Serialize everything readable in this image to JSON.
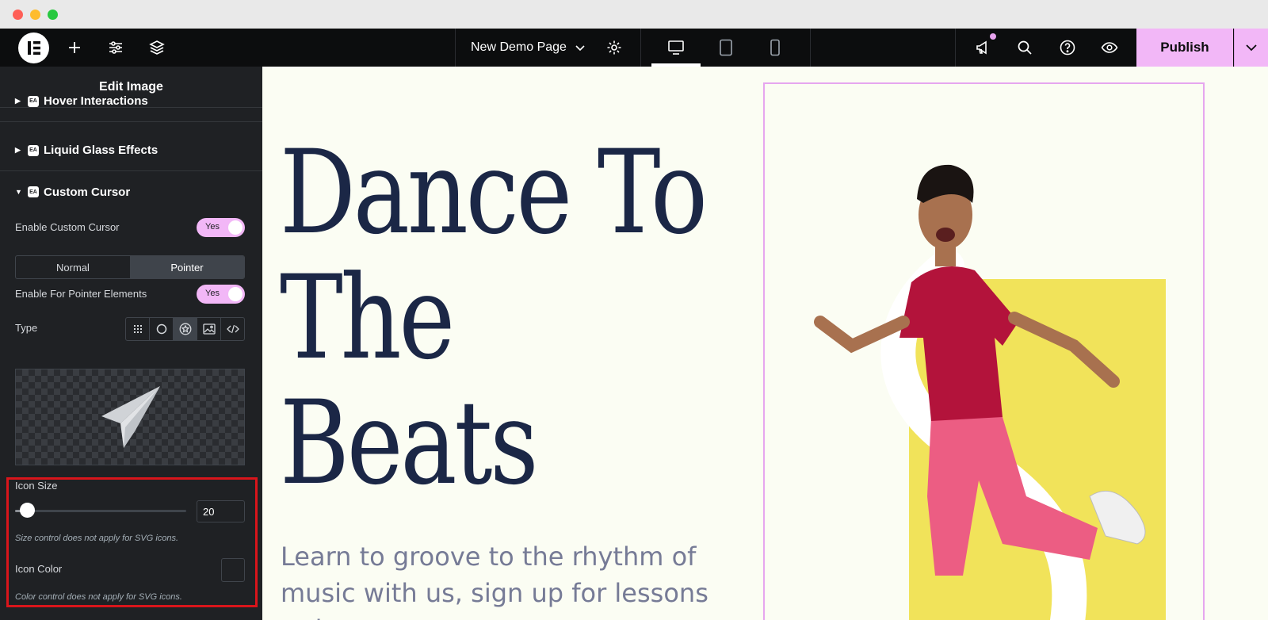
{
  "window": {
    "controls": [
      "close",
      "minimize",
      "zoom"
    ]
  },
  "topbar": {
    "page_name": "New Demo Page",
    "publish_label": "Publish",
    "icons": [
      "elementor-logo-icon",
      "add-icon",
      "settings-sliders-icon",
      "layers-icon",
      "chevron-down-icon",
      "gear-icon",
      "desktop-icon",
      "tablet-icon",
      "mobile-icon",
      "announcement-icon",
      "search-icon",
      "help-icon",
      "eye-icon"
    ]
  },
  "panel": {
    "title": "Edit Image",
    "sections": {
      "hover": "Hover Interactions",
      "liquid": "Liquid Glass Effects",
      "cursor": "Custom Cursor"
    },
    "badge": "EA",
    "enable_cursor_label": "Enable Custom Cursor",
    "enable_cursor_value": "Yes",
    "mode_normal": "Normal",
    "mode_pointer": "Pointer",
    "mode_selected": "Pointer",
    "pointer_elements_label": "Enable For Pointer Elements",
    "pointer_elements_value": "Yes",
    "type_label": "Type",
    "type_options": [
      "grid-icon",
      "circle-icon",
      "star-icon",
      "image-icon",
      "code-icon"
    ],
    "type_selected": "star-icon",
    "preview_icon": "paper-plane-icon",
    "icon_size_label": "Icon Size",
    "icon_size_value": "20",
    "icon_size_fraction": 0.07,
    "size_hint": "Size control does not apply for SVG icons.",
    "icon_color_label": "Icon Color",
    "color_hint": "Color control does not apply for SVG icons."
  },
  "canvas": {
    "headline": "Dance To\nThe\nBeats",
    "subtext": "Learn to groove to the rhythm of music with us, sign up for lessons today.",
    "image_subject": "dancer-photo",
    "colors": {
      "background": "#fbfdf3",
      "headline": "#1b2746",
      "accent": "#f2b7f7",
      "yellow": "#f1e35a"
    }
  }
}
